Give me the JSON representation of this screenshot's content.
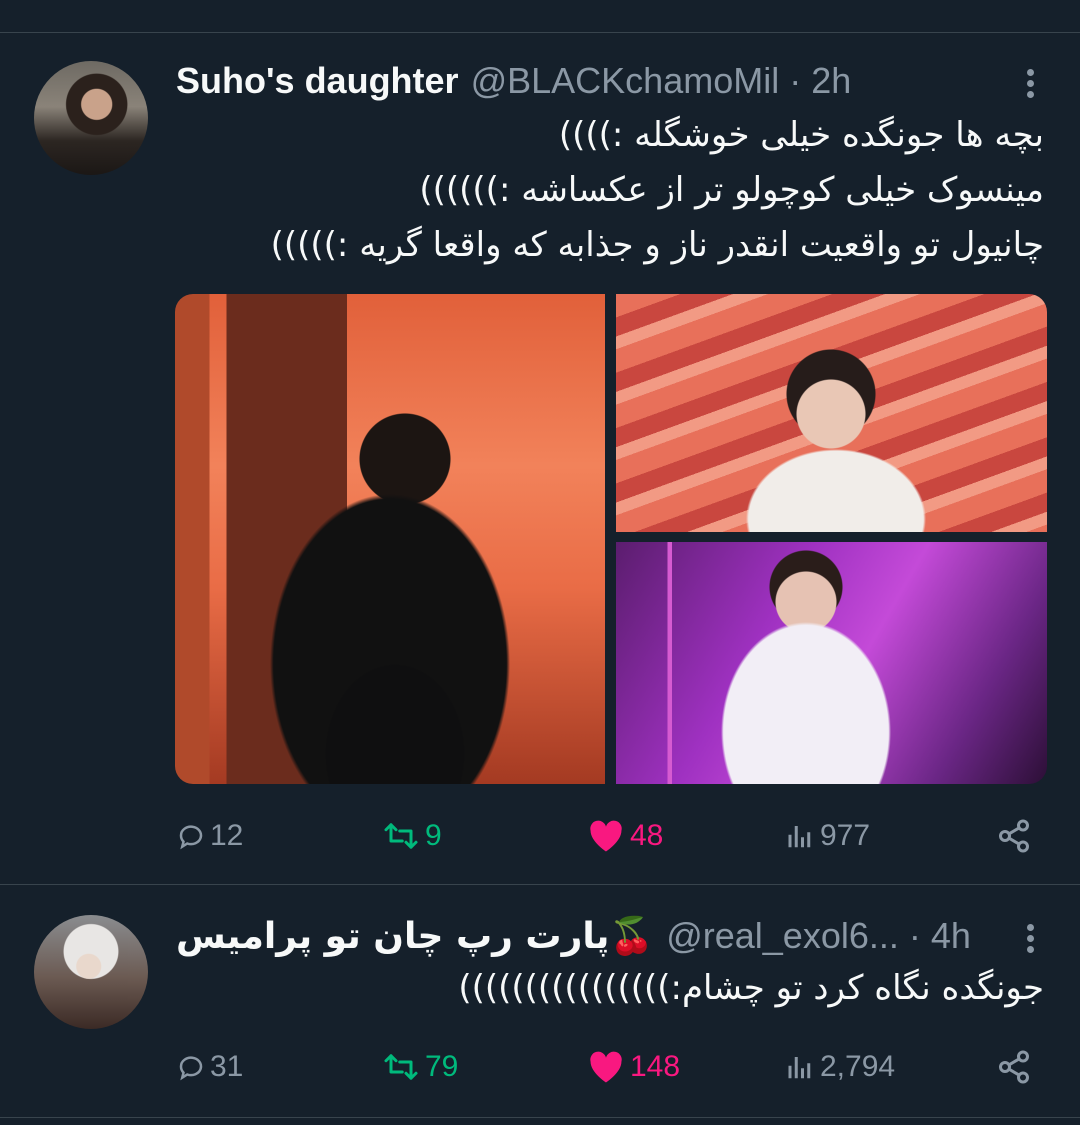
{
  "tweets": [
    {
      "display_name": "Suho's daughter",
      "handle": "@BLACKchamoMil",
      "separator": "·",
      "time": "2h",
      "text_lines": [
        "بچه ها جونگده خیلی خوشگله :))))",
        "مینسوک خیلی کوچولو تر از عکساشه :))))))",
        "چانیول تو واقعیت انقدر ناز و جذابه که واقعا گریه :)))))"
      ],
      "media_count": 3,
      "replies": "12",
      "retweets": "9",
      "likes": "48",
      "views": "977",
      "avatar_icon": "profile-photo"
    },
    {
      "display_name": "پارت رپ چان تو پرامیس🍒",
      "handle": "@real_exol6...",
      "separator": "·",
      "time": "4h",
      "text_lines": [
        "جونگده نگاه کرد تو چشام:))))))))))))))))"
      ],
      "replies": "31",
      "retweets": "79",
      "likes": "148",
      "views": "2,794",
      "avatar_icon": "profile-photo"
    }
  ],
  "icons": {
    "reply": "reply-icon",
    "retweet": "retweet-icon",
    "like": "heart-icon",
    "views": "views-icon",
    "share": "share-icon",
    "more": "more-icon"
  },
  "colors": {
    "background": "#15202b",
    "text": "#f7f9f9",
    "muted": "#8b98a5",
    "retweet": "#00ba7c",
    "like": "#f91880",
    "divider": "#38444d"
  }
}
